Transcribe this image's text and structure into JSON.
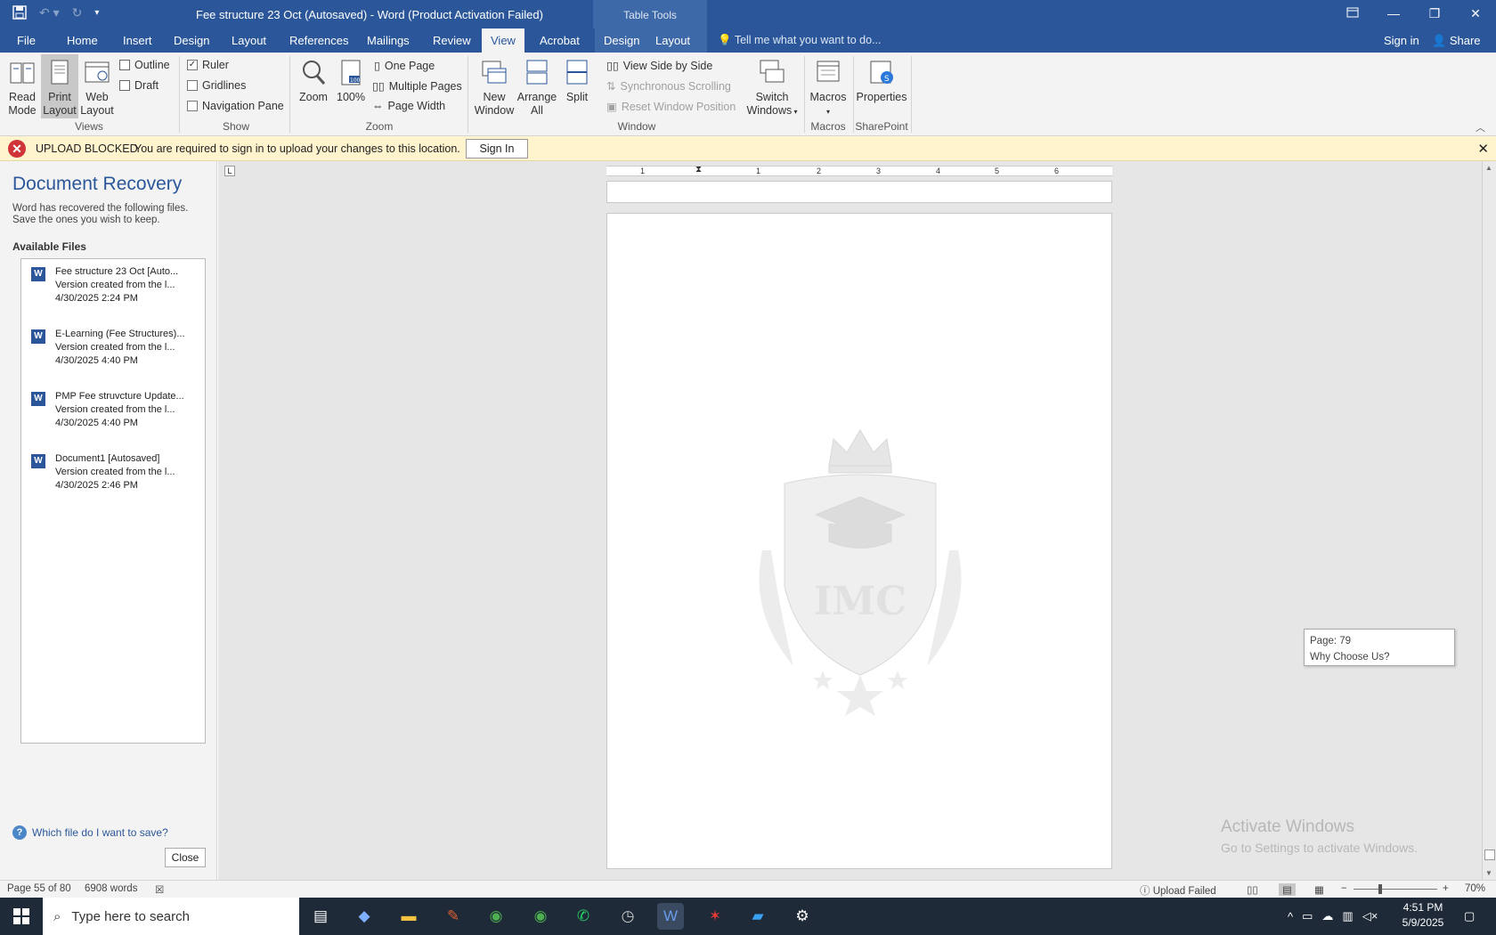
{
  "titlebar": {
    "title": "Fee structure 23 Oct (Autosaved) - Word (Product Activation Failed)",
    "table_tools": "Table Tools",
    "save_icon": "save-icon",
    "undo_icon": "undo-icon",
    "redo_icon": "redo-icon",
    "customize_icon": "customize-qat-icon"
  },
  "tabs": {
    "file": "File",
    "home": "Home",
    "insert": "Insert",
    "design": "Design",
    "layout": "Layout",
    "references": "References",
    "mailings": "Mailings",
    "review": "Review",
    "view": "View",
    "acrobat": "Acrobat",
    "tt_design": "Design",
    "tt_layout": "Layout",
    "tell_me": "Tell me what you want to do...",
    "sign_in": "Sign in",
    "share": "Share"
  },
  "ribbon": {
    "read_mode": [
      "Read",
      "Mode"
    ],
    "print_layout": [
      "Print",
      "Layout"
    ],
    "web_layout": [
      "Web",
      "Layout"
    ],
    "outline": "Outline",
    "draft": "Draft",
    "views_group": "Views",
    "ruler": "Ruler",
    "gridlines": "Gridlines",
    "navigation_pane": "Navigation Pane",
    "show_group": "Show",
    "zoom": "Zoom",
    "zoom100": "100%",
    "one_page": "One Page",
    "multiple_pages": "Multiple Pages",
    "page_width": "Page Width",
    "zoom_group": "Zoom",
    "new_window": [
      "New",
      "Window"
    ],
    "arrange_all": [
      "Arrange",
      "All"
    ],
    "split": "Split",
    "view_side_by_side": "View Side by Side",
    "synchronous_scrolling": "Synchronous Scrolling",
    "reset_window_position": "Reset Window Position",
    "switch_windows": [
      "Switch",
      "Windows"
    ],
    "window_group": "Window",
    "macros": "Macros",
    "macros_group": "Macros",
    "properties": "Properties",
    "sharepoint_group": "SharePoint"
  },
  "message_bar": {
    "title": "UPLOAD BLOCKED",
    "text": "You are required to sign in to upload your changes to this location.",
    "button": "Sign In"
  },
  "recovery": {
    "title": "Document Recovery",
    "description": "Word has recovered the following files. Save the ones you wish to keep.",
    "available_label": "Available Files",
    "files": [
      {
        "name": "Fee structure 23 Oct  [Auto...",
        "version": "Version created from the l...",
        "date": "4/30/2025 2:24 PM"
      },
      {
        "name": "E-Learning (Fee Structures)...",
        "version": "Version created from the l...",
        "date": "4/30/2025 4:40 PM"
      },
      {
        "name": "PMP Fee struvcture Update...",
        "version": "Version created from the l...",
        "date": "4/30/2025 4:40 PM"
      },
      {
        "name": "Document1  [Autosaved]",
        "version": "Version created from the l...",
        "date": "4/30/2025 2:46 PM"
      }
    ],
    "help_link": "Which file do I want to save?",
    "close": "Close"
  },
  "document": {
    "watermark_text": "IMC",
    "tooltip_page": "Page: 79",
    "tooltip_heading": "Why Choose Us?",
    "ruler_numbers": [
      "1",
      "1",
      "2",
      "3",
      "4",
      "5",
      "6"
    ]
  },
  "activate_windows": {
    "title": "Activate Windows",
    "subtitle": "Go to Settings to activate Windows."
  },
  "statusbar": {
    "page": "Page 55 of 80",
    "words": "6908 words",
    "upload": "Upload Failed",
    "zoom": "70%"
  },
  "taskbar": {
    "search_placeholder": "Type here to search",
    "time": "4:51 PM",
    "date": "5/9/2025"
  },
  "colors": {
    "word_blue": "#2b579a",
    "message_bar": "#fff4ce",
    "error_red": "#d13438"
  }
}
